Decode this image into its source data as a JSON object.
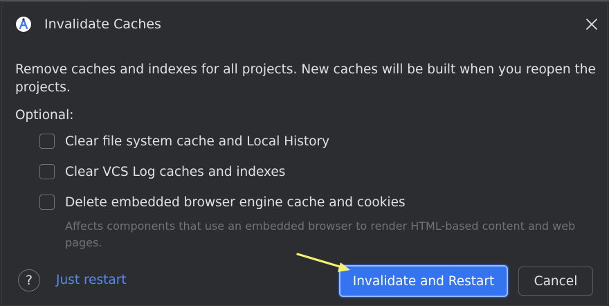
{
  "dialog": {
    "title": "Invalidate Caches",
    "icon": "android-studio-icon",
    "description": "Remove caches and indexes for all projects. New caches will be built when you reopen the projects.",
    "optional_label": "Optional:",
    "options": [
      {
        "label": "Clear file system cache and Local History",
        "checked": false
      },
      {
        "label": "Clear VCS Log caches and indexes",
        "checked": false
      },
      {
        "label": "Delete embedded browser engine cache and cookies",
        "checked": false
      }
    ],
    "browser_hint": "Affects components that use an embedded browser to render HTML-based content and web pages.",
    "help_label": "?",
    "just_restart": "Just restart",
    "primary_button": "Invalidate and Restart",
    "cancel_button": "Cancel"
  },
  "colors": {
    "background": "#2b2d30",
    "primary": "#3574f0",
    "link": "#548af7",
    "annotation_arrow": "#f5f06e"
  }
}
